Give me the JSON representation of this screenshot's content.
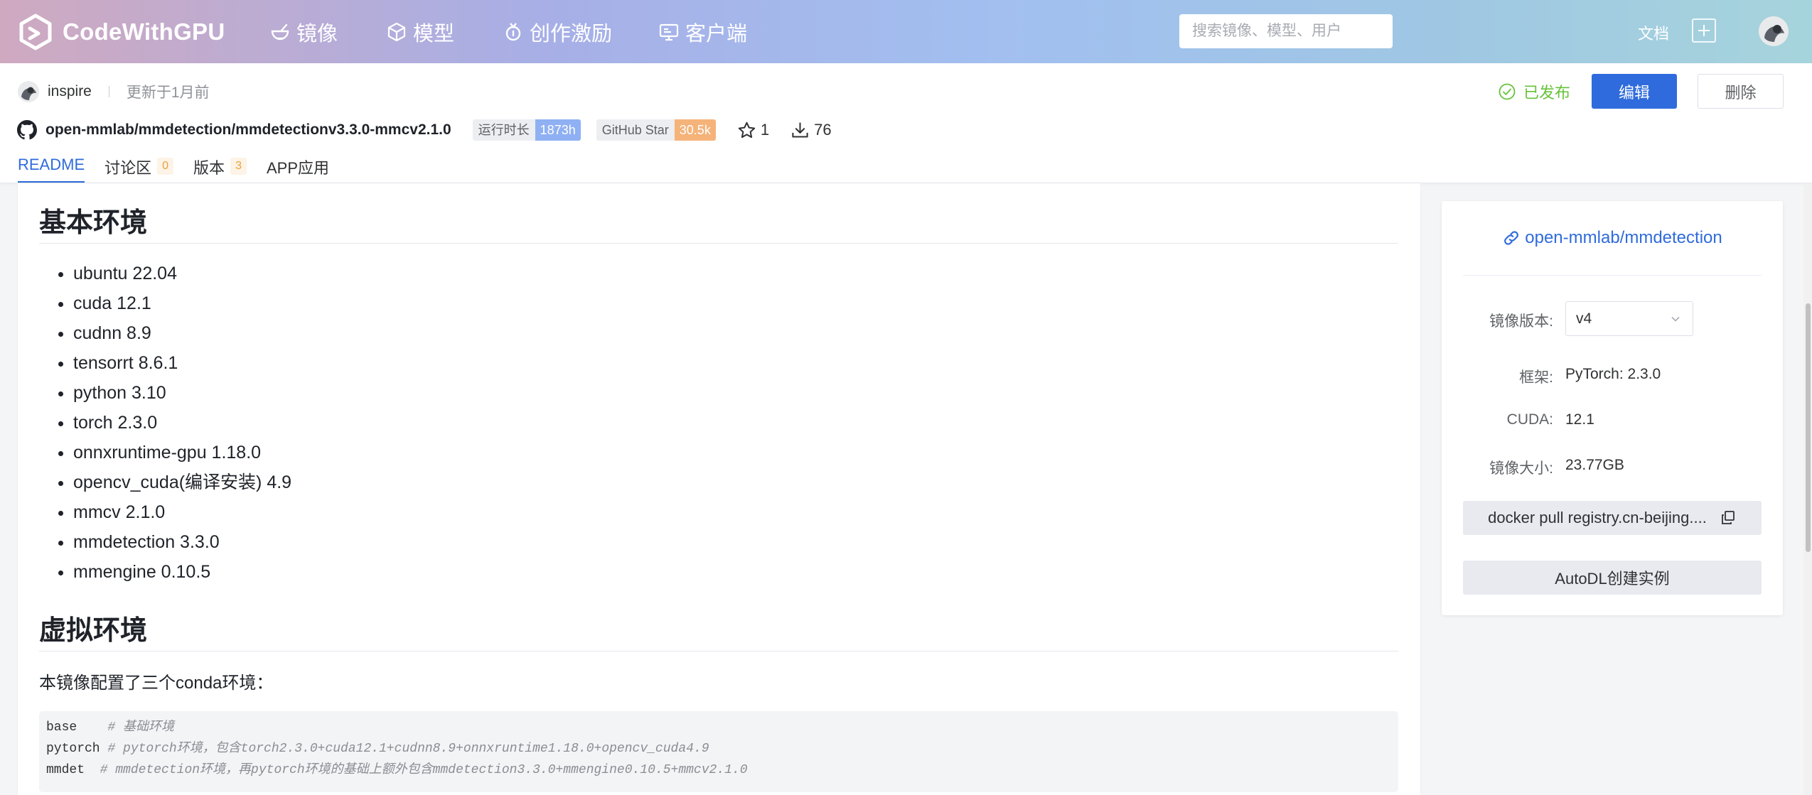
{
  "nav": {
    "brand": "CodeWithGPU",
    "items": [
      {
        "label": "镜像",
        "icon": "bowl-icon"
      },
      {
        "label": "模型",
        "icon": "cube-icon"
      },
      {
        "label": "创作激励",
        "icon": "medal-icon"
      },
      {
        "label": "客户端",
        "icon": "monitor-icon"
      }
    ],
    "search_placeholder": "搜索镜像、模型、用户",
    "docs": "文档"
  },
  "header": {
    "author": "inspire",
    "updated": "更新于1月前",
    "status": "已发布",
    "edit_label": "编辑",
    "delete_label": "删除",
    "repo_name": "open-mmlab/mmdetection/mmdetectionv3.3.0-mmcv2.1.0",
    "runtime_label": "运行时长",
    "runtime_value": "1873h",
    "stars_label": "GitHub Star",
    "stars_value": "30.5k",
    "favorites": "1",
    "downloads": "76",
    "tabs": [
      {
        "label": "README"
      },
      {
        "label": "讨论区",
        "count": "0"
      },
      {
        "label": "版本",
        "count": "3"
      },
      {
        "label": "APP应用"
      }
    ]
  },
  "readme": {
    "heading1": "基本环境",
    "env_list": [
      "ubuntu 22.04",
      "cuda 12.1",
      "cudnn 8.9",
      "tensorrt 8.6.1",
      "python 3.10",
      "torch 2.3.0",
      "onnxruntime-gpu 1.18.0",
      "opencv_cuda(编译安装) 4.9",
      "mmcv 2.1.0",
      "mmdetection 3.3.0",
      "mmengine 0.10.5"
    ],
    "heading2": "虚拟环境",
    "intro": "本镜像配置了三个conda环境：",
    "code": [
      {
        "name": "base    ",
        "comment": "# 基础环境"
      },
      {
        "name": "pytorch ",
        "comment": "# pytorch环境，包含torch2.3.0+cuda12.1+cudnn8.9+onnxruntime1.18.0+opencv_cuda4.9"
      },
      {
        "name": "mmdet  ",
        "comment": "# mmdetection环境，再pytorch环境的基础上额外包含mmdetection3.3.0+mmengine0.10.5+mmcv2.1.0"
      }
    ]
  },
  "sidebar": {
    "repo_link": "open-mmlab/mmdetection",
    "version_label": "镜像版本:",
    "version_value": "v4",
    "framework_label": "框架:",
    "framework_value": "PyTorch: 2.3.0",
    "cuda_label": "CUDA:",
    "cuda_value": "12.1",
    "size_label": "镜像大小:",
    "size_value": "23.77GB",
    "docker_cmd": "docker pull registry.cn-beijing....",
    "autodl_label": "AutoDL创建实例"
  },
  "colors": {
    "primary": "#2f6bdc",
    "success": "#67c23a",
    "runtime_tag": "#8fb0f3",
    "star_tag": "#f5b37a"
  }
}
